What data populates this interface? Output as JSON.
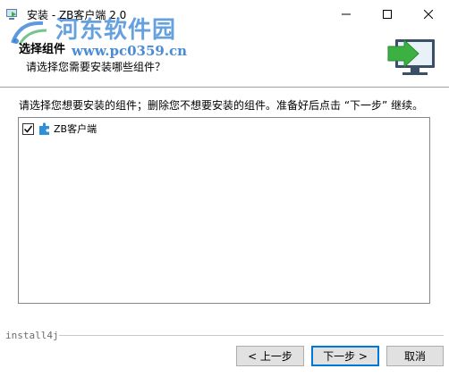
{
  "window": {
    "title": "安装 - ZB客户端 2.0",
    "minimize_icon": "minimize-icon",
    "maximize_icon": "maximize-icon",
    "close_icon": "close-icon"
  },
  "watermark": {
    "title": "河东软件园",
    "url": "www.pc0359.cn"
  },
  "header": {
    "title": "选择组件",
    "subtitle": "请选择您需要安装哪些组件？",
    "graphic_icon": "computer-install-arrow-icon"
  },
  "main": {
    "instruction": "请选择您想要安装的组件；删除您不想要安装的组件。准备好后点击 “下一步” 继续。",
    "components": [
      {
        "label": "ZB客户端",
        "checked": true,
        "icon": "puzzle-piece-icon"
      }
    ]
  },
  "branding": "install4j",
  "buttons": {
    "back": "< 上一步",
    "next": "下一步 >",
    "cancel": "取消"
  },
  "colors": {
    "accent": "#0078d7",
    "header_graphic_green": "#3cb043",
    "component_icon_blue": "#2f8fd8"
  }
}
